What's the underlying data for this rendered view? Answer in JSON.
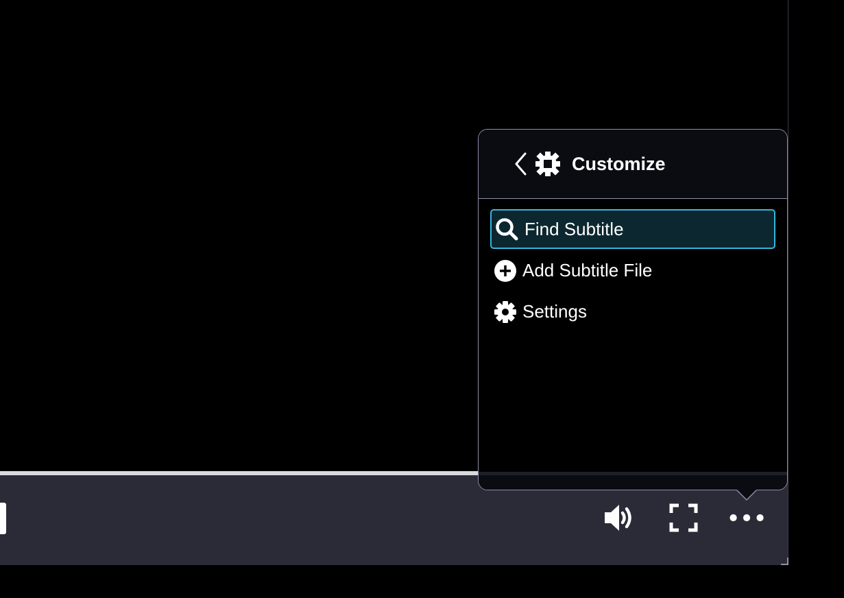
{
  "player": {
    "progress_percent": 60.7,
    "colors": {
      "control_bar": "#2b2b38",
      "progress_fill": "#d9d9dd",
      "icon": "#ffffff"
    },
    "controls": [
      {
        "id": "volume",
        "icon": "volume-high-icon"
      },
      {
        "id": "fullscreen",
        "icon": "fullscreen-icon"
      },
      {
        "id": "more",
        "icon": "more-horizontal-icon"
      }
    ]
  },
  "menu": {
    "title": "Customize",
    "back_icon": "chevron-left-icon",
    "header_icon": "gear-icon",
    "accent_color": "#36b6dc",
    "items": [
      {
        "label": "Find Subtitle",
        "icon": "search-icon",
        "selected": true
      },
      {
        "label": "Add Subtitle File",
        "icon": "plus-circle-icon",
        "selected": false
      },
      {
        "label": "Settings",
        "icon": "gear-icon",
        "selected": false
      }
    ]
  }
}
